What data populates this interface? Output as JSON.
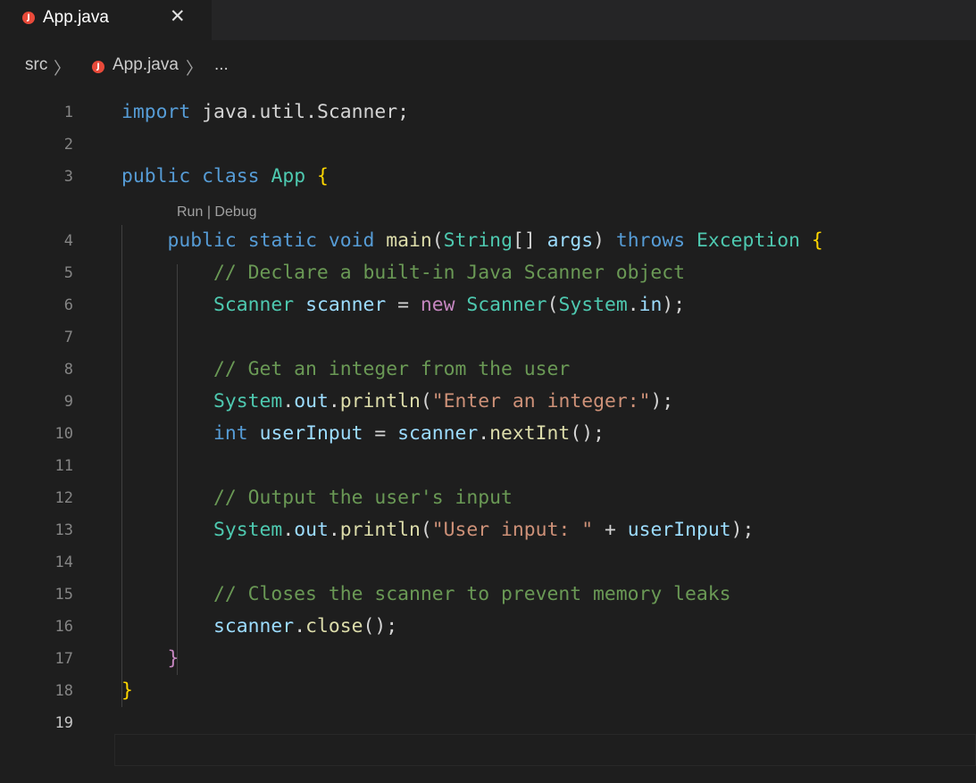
{
  "tab": {
    "icon": "java-file-icon",
    "icon_letter": "J",
    "label": "App.java",
    "close_glyph": "✕"
  },
  "breadcrumb": {
    "folder": "src",
    "sep": "〉",
    "file": "App.java",
    "more": "..."
  },
  "codelens": {
    "run": "Run",
    "sep": "|",
    "debug": "Debug"
  },
  "editor": {
    "active_line": 19,
    "lines": [
      {
        "n": "1",
        "tokens": [
          [
            "k",
            "import"
          ],
          [
            "p",
            " java.util.Scanner;"
          ]
        ]
      },
      {
        "n": "2",
        "tokens": []
      },
      {
        "n": "3",
        "tokens": [
          [
            "k",
            "public"
          ],
          [
            "p",
            " "
          ],
          [
            "k",
            "class"
          ],
          [
            "p",
            " "
          ],
          [
            "t",
            "App"
          ],
          [
            "p",
            " "
          ],
          [
            "b",
            "{"
          ]
        ]
      },
      {
        "n": "4",
        "tokens": [
          [
            "p",
            "    "
          ],
          [
            "k",
            "public"
          ],
          [
            "p",
            " "
          ],
          [
            "k",
            "static"
          ],
          [
            "p",
            " "
          ],
          [
            "k",
            "void"
          ],
          [
            "p",
            " "
          ],
          [
            "f",
            "main"
          ],
          [
            "p",
            "("
          ],
          [
            "t",
            "String"
          ],
          [
            "p",
            "[] "
          ],
          [
            "v",
            "args"
          ],
          [
            "p",
            ") "
          ],
          [
            "k",
            "throws"
          ],
          [
            "p",
            " "
          ],
          [
            "t",
            "Exception"
          ],
          [
            "p",
            " "
          ],
          [
            "b",
            "{"
          ]
        ]
      },
      {
        "n": "5",
        "tokens": [
          [
            "p",
            "        "
          ],
          [
            "c",
            "// Declare a built-in Java Scanner object"
          ]
        ]
      },
      {
        "n": "6",
        "tokens": [
          [
            "p",
            "        "
          ],
          [
            "t",
            "Scanner"
          ],
          [
            "p",
            " "
          ],
          [
            "v",
            "scanner"
          ],
          [
            "p",
            " = "
          ],
          [
            "kc",
            "new"
          ],
          [
            "p",
            " "
          ],
          [
            "t",
            "Scanner"
          ],
          [
            "p",
            "("
          ],
          [
            "t",
            "System"
          ],
          [
            "p",
            "."
          ],
          [
            "v",
            "in"
          ],
          [
            "p",
            ");"
          ]
        ]
      },
      {
        "n": "7",
        "tokens": []
      },
      {
        "n": "8",
        "tokens": [
          [
            "p",
            "        "
          ],
          [
            "c",
            "// Get an integer from the user"
          ]
        ]
      },
      {
        "n": "9",
        "tokens": [
          [
            "p",
            "        "
          ],
          [
            "t",
            "System"
          ],
          [
            "p",
            "."
          ],
          [
            "v",
            "out"
          ],
          [
            "p",
            "."
          ],
          [
            "f",
            "println"
          ],
          [
            "p",
            "("
          ],
          [
            "s",
            "\"Enter an integer:\""
          ],
          [
            "p",
            ");"
          ]
        ]
      },
      {
        "n": "10",
        "tokens": [
          [
            "p",
            "        "
          ],
          [
            "k",
            "int"
          ],
          [
            "p",
            " "
          ],
          [
            "v",
            "userInput"
          ],
          [
            "p",
            " = "
          ],
          [
            "v",
            "scanner"
          ],
          [
            "p",
            "."
          ],
          [
            "f",
            "nextInt"
          ],
          [
            "p",
            "();"
          ]
        ]
      },
      {
        "n": "11",
        "tokens": []
      },
      {
        "n": "12",
        "tokens": [
          [
            "p",
            "        "
          ],
          [
            "c",
            "// Output the user's input"
          ]
        ]
      },
      {
        "n": "13",
        "tokens": [
          [
            "p",
            "        "
          ],
          [
            "t",
            "System"
          ],
          [
            "p",
            "."
          ],
          [
            "v",
            "out"
          ],
          [
            "p",
            "."
          ],
          [
            "f",
            "println"
          ],
          [
            "p",
            "("
          ],
          [
            "s",
            "\"User input: \""
          ],
          [
            "p",
            " + "
          ],
          [
            "v",
            "userInput"
          ],
          [
            "p",
            ");"
          ]
        ]
      },
      {
        "n": "14",
        "tokens": []
      },
      {
        "n": "15",
        "tokens": [
          [
            "p",
            "        "
          ],
          [
            "c",
            "// Closes the scanner to prevent memory leaks"
          ]
        ]
      },
      {
        "n": "16",
        "tokens": [
          [
            "p",
            "        "
          ],
          [
            "v",
            "scanner"
          ],
          [
            "p",
            "."
          ],
          [
            "f",
            "close"
          ],
          [
            "p",
            "();"
          ]
        ]
      },
      {
        "n": "17",
        "tokens": [
          [
            "p",
            "    "
          ],
          [
            "kc",
            "}"
          ]
        ]
      },
      {
        "n": "18",
        "tokens": [
          [
            "b",
            "}"
          ]
        ]
      },
      {
        "n": "19",
        "tokens": []
      }
    ]
  }
}
